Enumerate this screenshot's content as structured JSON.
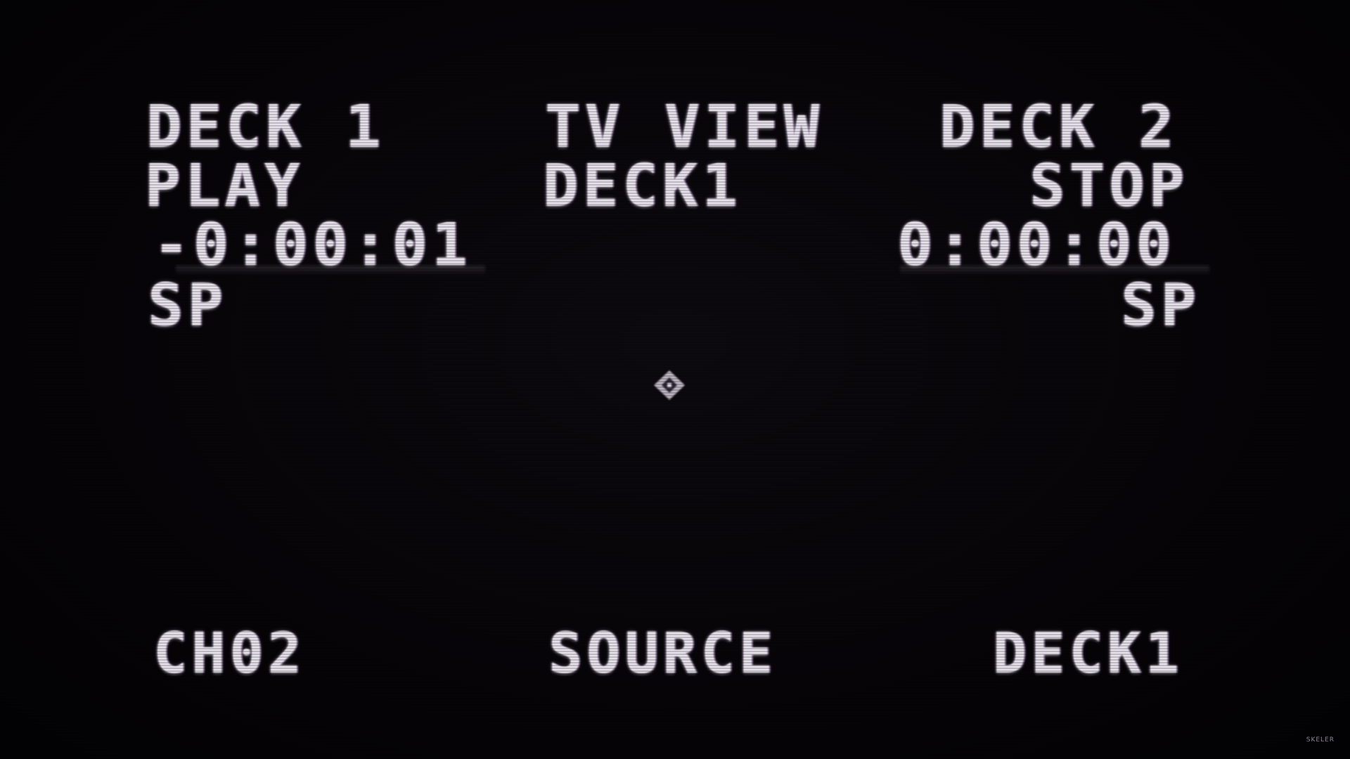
{
  "deck1": {
    "title": "DECK 1",
    "status": "PLAY",
    "timecode": "-0:00:01",
    "speed": "SP"
  },
  "tv_view": {
    "title": "TV VIEW",
    "source": "DECK1"
  },
  "deck2": {
    "title": "DECK 2",
    "status": "STOP",
    "timecode": "0:00:00",
    "speed": "SP"
  },
  "footer": {
    "channel": "CH02",
    "source_label": "SOURCE",
    "source_value": "DECK1"
  },
  "crosshair_icon": "diamond-crosshair-icon",
  "watermark": "SKELER"
}
